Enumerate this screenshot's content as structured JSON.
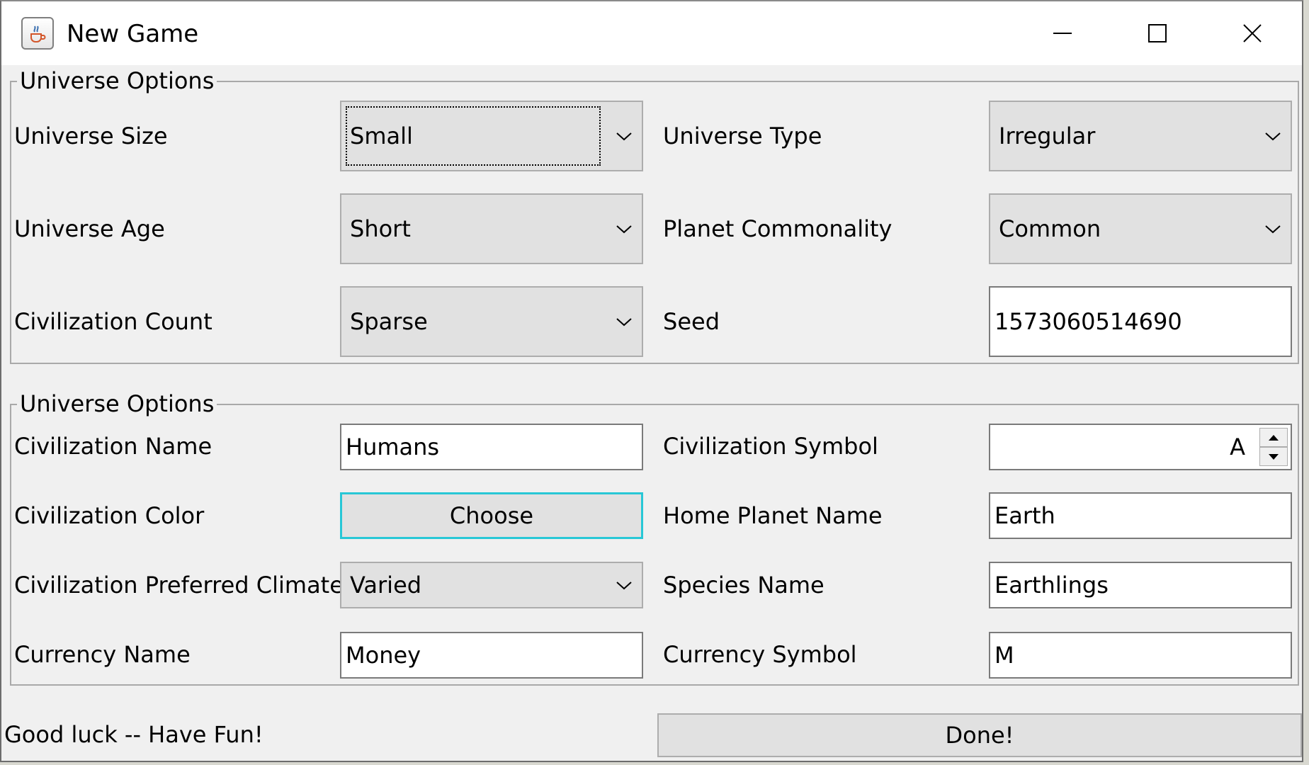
{
  "window": {
    "title": "New Game",
    "controls": {
      "minimize": "minimize",
      "maximize": "maximize",
      "close": "close"
    }
  },
  "universe_group": {
    "legend": "Universe Options",
    "size": {
      "label": "Universe Size",
      "value": "Small"
    },
    "type": {
      "label": "Universe Type",
      "value": "Irregular"
    },
    "age": {
      "label": "Universe Age",
      "value": "Short"
    },
    "planet_commonality": {
      "label": "Planet Commonality",
      "value": "Common"
    },
    "civ_count": {
      "label": "Civilization Count",
      "value": "Sparse"
    },
    "seed": {
      "label": "Seed",
      "value": "1573060514690"
    }
  },
  "civ_group": {
    "legend": "Universe Options",
    "civ_name": {
      "label": "Civilization Name",
      "value": "Humans"
    },
    "civ_symbol": {
      "label": "Civilization Symbol",
      "value": "A"
    },
    "civ_color": {
      "label": "Civilization Color",
      "button": "Choose"
    },
    "home_planet": {
      "label": "Home Planet Name",
      "value": "Earth"
    },
    "climate": {
      "label": "Civilization Preferred Climate",
      "value": "Varied"
    },
    "species": {
      "label": "Species Name",
      "value": "Earthlings"
    },
    "currency_name": {
      "label": "Currency Name",
      "value": "Money"
    },
    "currency_symbol": {
      "label": "Currency Symbol",
      "value": "M"
    }
  },
  "footer": {
    "message": "Good luck -- Have Fun!",
    "done_label": "Done!"
  },
  "icons": {
    "app": "java-coffee-cup-icon",
    "dropdown": "chevron-down-icon",
    "spinner_up": "caret-up-icon",
    "spinner_down": "caret-down-icon"
  },
  "colors": {
    "focus_accent": "#28c7d6",
    "combo_bg": "#e1e1e1",
    "window_bg": "#f0f0f0"
  }
}
